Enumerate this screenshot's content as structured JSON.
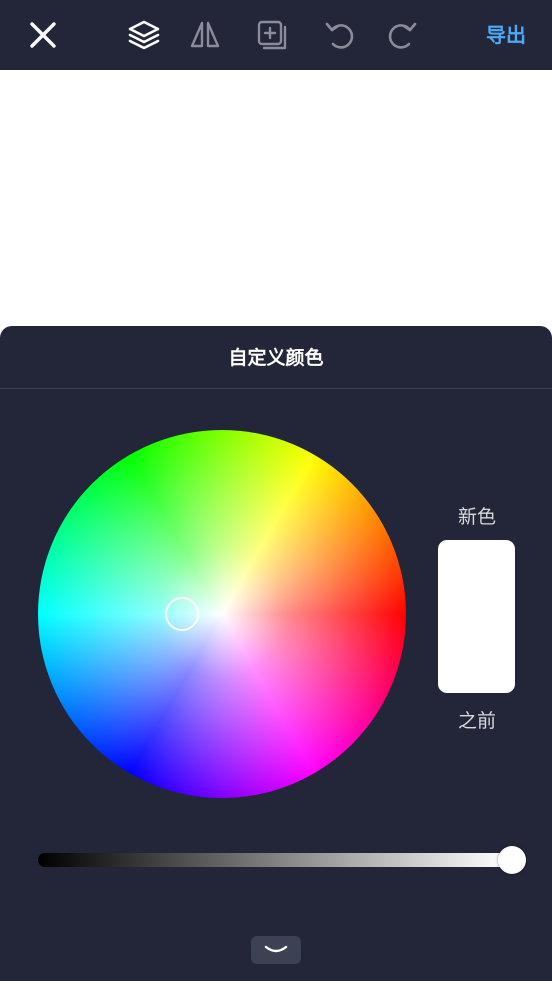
{
  "toolbar": {
    "icons": {
      "close": "close-icon",
      "layers": "layers-icon",
      "flip": "flip-icon",
      "add_layer": "add-layer-icon",
      "undo": "undo-icon",
      "redo": "redo-icon"
    },
    "export_label": "导出",
    "colors": {
      "background": "#222638",
      "export": "#4ea9f5",
      "icon_active": "#ffffff",
      "icon_dim": "#8a8d99"
    }
  },
  "panel": {
    "title": "自定义颜色",
    "new_color_label": "新色",
    "previous_label": "之前",
    "new_color": "#ffffff",
    "brightness": 1.0,
    "collapse_icon": "chevron-down-icon",
    "background": "#222638"
  }
}
